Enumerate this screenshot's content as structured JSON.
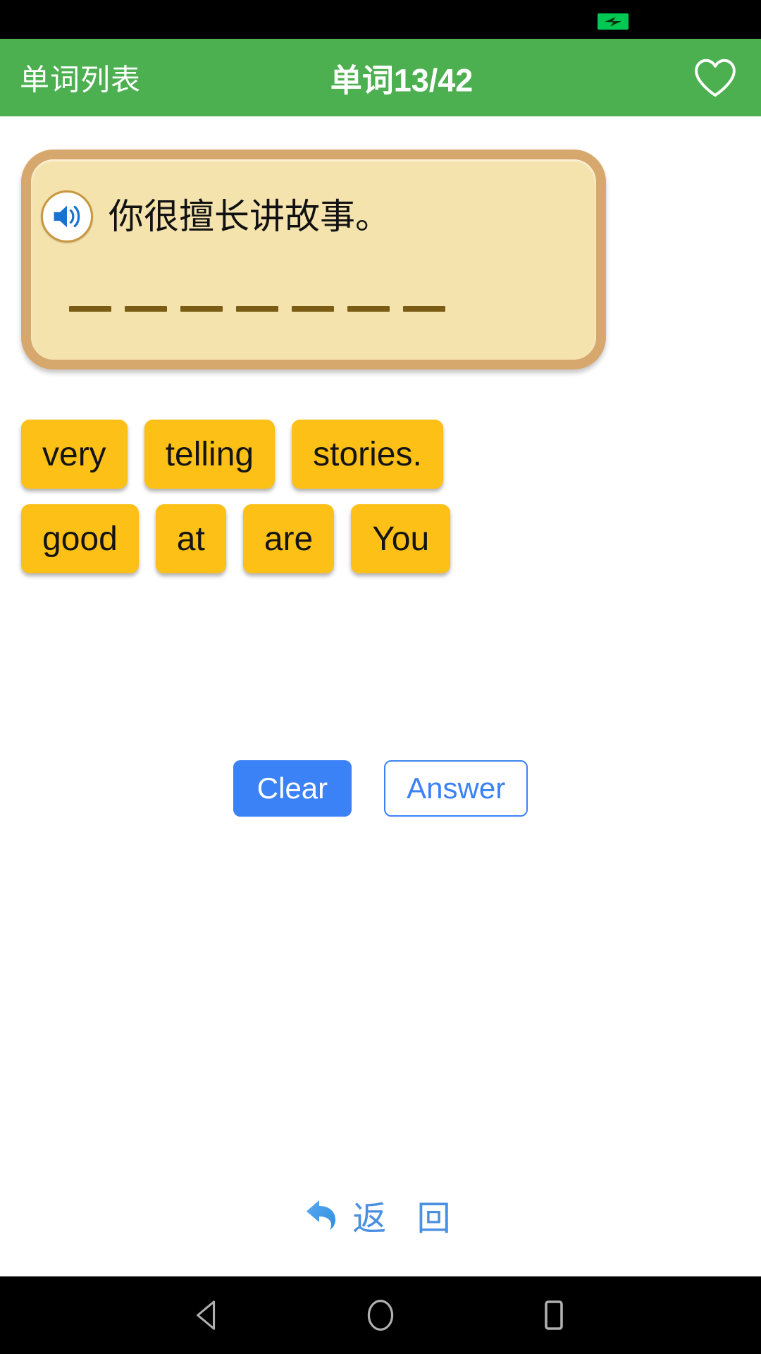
{
  "status_bar": {
    "battery_icon": "battery-charging-icon",
    "battery_color": "#00c853"
  },
  "app_bar": {
    "back_label": "单词列表",
    "title": "单词13/42",
    "favorite_icon": "heart-outline-icon",
    "background_color": "#4caf50"
  },
  "card": {
    "speaker_icon": "speaker-volume-icon",
    "sentence_cn": "你很擅长讲故事。",
    "blank_count": 7,
    "background_color": "#f5e3ae",
    "border_color": "#d7a86e",
    "blank_color": "#7a5c14"
  },
  "word_tiles": {
    "color": "#fcc017",
    "rows": [
      [
        "very",
        "telling",
        "stories."
      ],
      [
        "good",
        "at",
        "are",
        "You"
      ]
    ]
  },
  "actions": {
    "clear_label": "Clear",
    "answer_label": "Answer",
    "primary_color": "#3b82f6"
  },
  "back_link": {
    "icon": "back-arrow-icon",
    "label": "返 回",
    "color": "#4a90e2"
  },
  "nav_bar": {
    "back_icon": "triangle-back-icon",
    "home_icon": "circle-home-icon",
    "recents_icon": "square-recents-icon"
  }
}
